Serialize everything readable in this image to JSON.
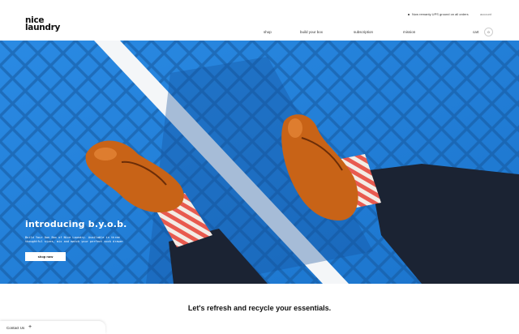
{
  "announcement": {
    "text": "Now remanty UPS ground on all orders",
    "account_label": "account"
  },
  "logo": {
    "line1": "nice",
    "line2": "laundry"
  },
  "nav": {
    "items": [
      {
        "label": "shop"
      },
      {
        "label": "build your box"
      },
      {
        "label": "subscription"
      },
      {
        "label": "mission"
      }
    ],
    "cart_label": "cart",
    "cart_count": "0"
  },
  "hero": {
    "title": "introducing b.y.o.b.",
    "copy": "Build Your Own Box of Nice Laundry. Available in three thoughtful sizes, mix and match your perfect sock drawer",
    "button_label": "shop now"
  },
  "main": {
    "tagline": "Let's refresh and recycle your essentials."
  },
  "contact": {
    "label": "Contact Us",
    "plus": "+"
  },
  "colors": {
    "court_blue": "#1f7fd8",
    "shoe_orange": "#c86317",
    "sock_red": "#e85a4f",
    "pants": "#1b2333"
  }
}
